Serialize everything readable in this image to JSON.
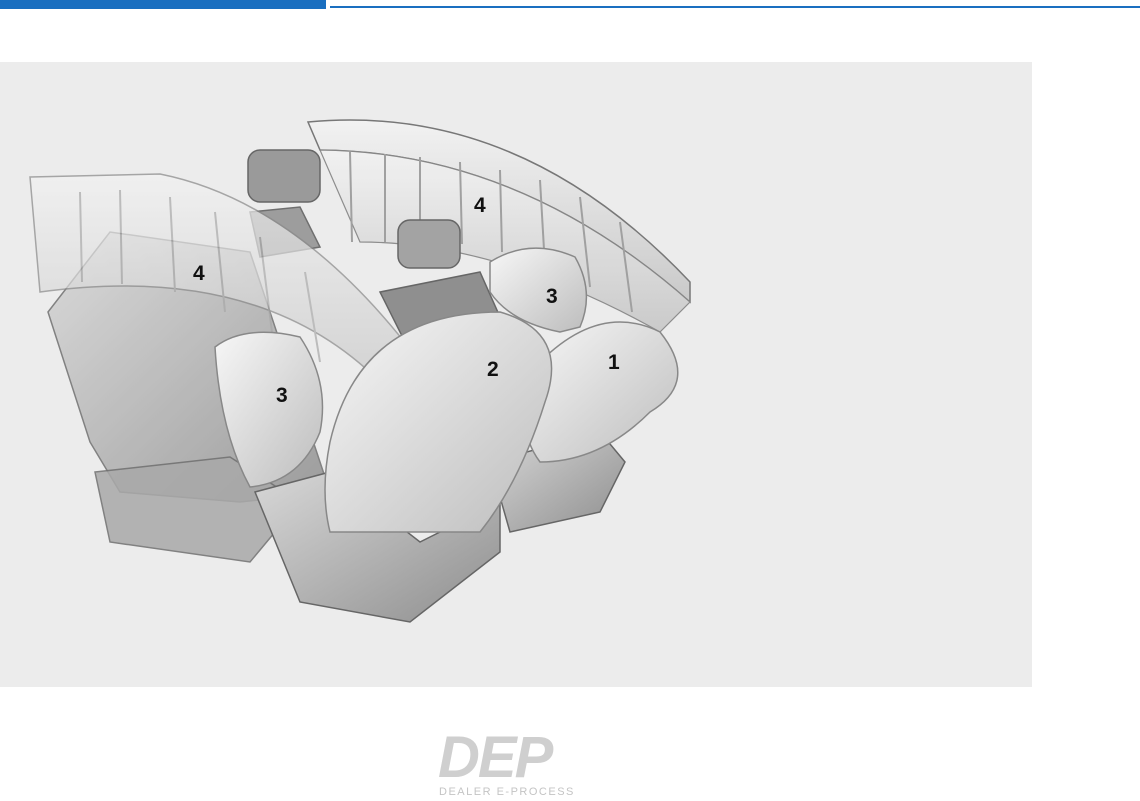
{
  "figure": {
    "callouts": [
      {
        "id": "callout-1",
        "label": "1"
      },
      {
        "id": "callout-2",
        "label": "2"
      },
      {
        "id": "callout-3a",
        "label": "3"
      },
      {
        "id": "callout-3b",
        "label": "3"
      },
      {
        "id": "callout-4a",
        "label": "4"
      },
      {
        "id": "callout-4b",
        "label": "4"
      }
    ]
  },
  "watermark": {
    "mark": "DEP",
    "subtitle": "DEALER E-PROCESS"
  },
  "colors": {
    "accent": "#1a6fc0",
    "panel": "#ececec"
  }
}
